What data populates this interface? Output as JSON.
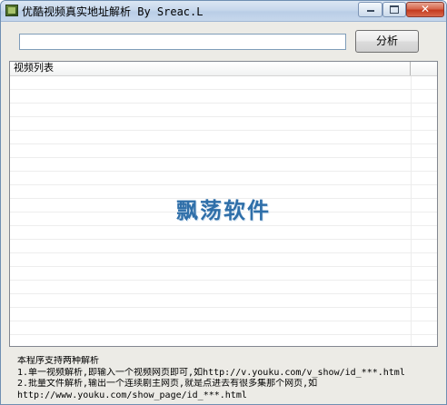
{
  "window": {
    "title": "优酷视频真实地址解析 By Sreac.L",
    "controls": {
      "minimize": "minimize",
      "maximize": "maximize",
      "close": "✕"
    }
  },
  "toolbar": {
    "url_value": "",
    "parse_label": "分析"
  },
  "list": {
    "column_header": "视频列表",
    "rows": [],
    "watermark": "飘荡软件"
  },
  "info": {
    "lines": [
      "本程序支持两种解析",
      "1.单一视频解析,即输入一个视频网页即可,如http://v.youku.com/v_show/id_***.html",
      "2.批量文件解析,输出一个连续剧主网页,就是点进去有很多集那个网页,如",
      "http://www.youku.com/show_page/id_***.html"
    ]
  },
  "icons": {
    "app": "app-icon",
    "minimize": "minimize-icon",
    "maximize": "maximize-icon",
    "close": "close-icon"
  },
  "colors": {
    "titlebar": "#c7d8ec",
    "close_button": "#c43b1f",
    "watermark": "#2f6fa9",
    "window_bg": "#ecebe6"
  }
}
